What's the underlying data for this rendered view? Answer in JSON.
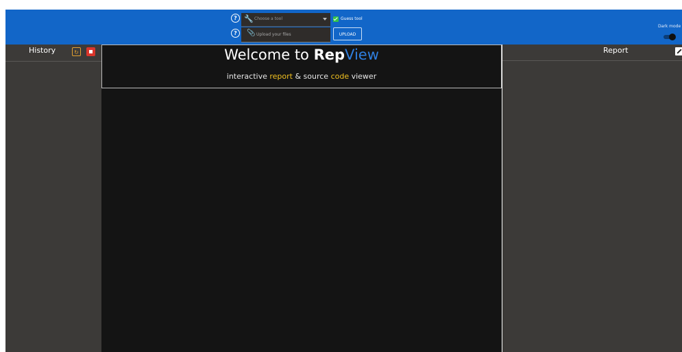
{
  "header": {
    "tool_select": {
      "placeholder": "Choose a tool"
    },
    "guess_tool": {
      "label": "Guess tool",
      "checked": true
    },
    "upload_field": {
      "placeholder": "Upload your files"
    },
    "upload_button": {
      "label": "UPLOAD"
    },
    "dark_mode": {
      "label": "Dark mode",
      "enabled": true
    }
  },
  "history": {
    "title": "History"
  },
  "welcome": {
    "title_prefix": "Welcome to ",
    "title_rep": "Rep",
    "title_view": "View",
    "sub_1": "interactive ",
    "sub_report": "report",
    "sub_2": " & source ",
    "sub_code": "code",
    "sub_3": " viewer"
  },
  "report": {
    "title": "Report"
  },
  "colors": {
    "header_bg": "#1266c8",
    "panel_bg": "#3c3a38",
    "main_bg": "#141414",
    "accent_blue": "#2f7fe0",
    "accent_yellow": "#f0c020",
    "refresh_orange": "#e6a230",
    "delete_red": "#d9352b",
    "check_green": "#35c24a"
  },
  "icons": [
    "help-icon",
    "wrench-icon",
    "paperclip-icon",
    "refresh-icon",
    "trash-icon",
    "edit-icon",
    "chevron-down-icon"
  ]
}
